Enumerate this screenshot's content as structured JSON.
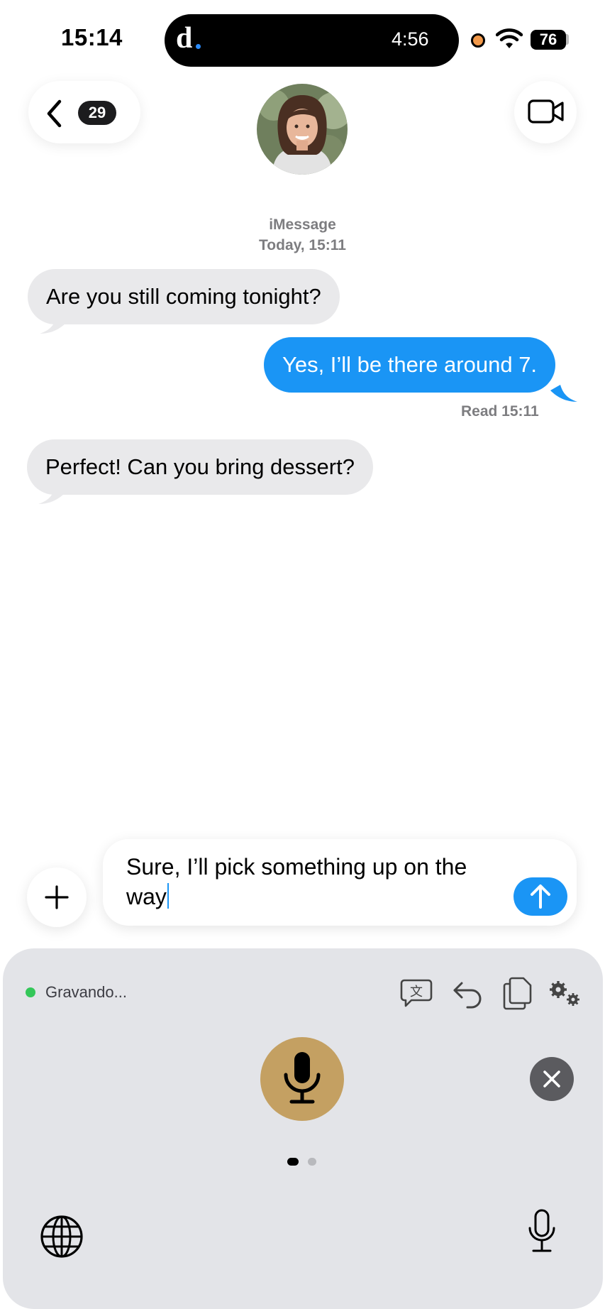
{
  "status_bar": {
    "time": "15:14",
    "island_logo": "d",
    "island_timer": "4:56",
    "battery": "76"
  },
  "header": {
    "back_badge": "29",
    "contact_avatar": "avatar",
    "video_icon": "video-camera-icon"
  },
  "conversation": {
    "service": "iMessage",
    "date": "Today, 15:11",
    "messages": [
      {
        "direction": "incoming",
        "text": "Are you still coming tonight?"
      },
      {
        "direction": "outgoing",
        "text": "Yes, I’ll be there around 7."
      },
      {
        "direction": "incoming",
        "text": "Perfect! Can you bring dessert?"
      }
    ],
    "read_receipt": "Read 15:11"
  },
  "composer": {
    "text_line1": "Sure, I’ll pick something up on the",
    "text_line2": "way"
  },
  "keyboard": {
    "status": "Gravando...",
    "status_color": "#34c759",
    "mic_color": "#c4a062",
    "page_indicator": {
      "pages": 2,
      "current": 1
    },
    "tools": [
      "translate-icon",
      "undo-icon",
      "copy-icon",
      "settings-icon"
    ]
  },
  "colors": {
    "accent": "#1a95f5",
    "incoming_bubble": "#e9e9eb",
    "panel": "#e3e4e8"
  }
}
